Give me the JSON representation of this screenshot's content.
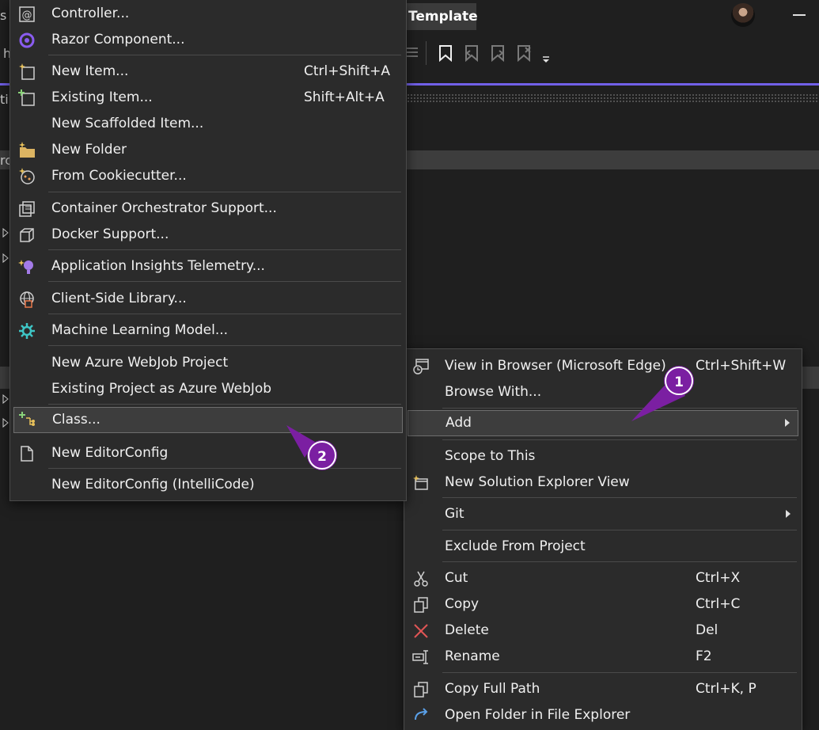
{
  "titlebar": {
    "title": "Template",
    "left_fragment": "s"
  },
  "left_edge": {
    "items": [
      "h",
      "ti",
      "rc"
    ]
  },
  "left_menu": {
    "items": [
      {
        "label": "Controller...",
        "shortcut": "",
        "icon": "controller-icon"
      },
      {
        "label": "Razor Component...",
        "shortcut": "",
        "icon": "razor-component-icon"
      },
      {
        "label": "New Item...",
        "shortcut": "Ctrl+Shift+A",
        "icon": "new-item-icon"
      },
      {
        "label": "Existing Item...",
        "shortcut": "Shift+Alt+A",
        "icon": "existing-item-icon"
      },
      {
        "label": "New Scaffolded Item...",
        "shortcut": "",
        "icon": ""
      },
      {
        "label": "New Folder",
        "shortcut": "",
        "icon": "new-folder-icon"
      },
      {
        "label": "From Cookiecutter...",
        "shortcut": "",
        "icon": "cookiecutter-icon"
      },
      {
        "label": "Container Orchestrator Support...",
        "shortcut": "",
        "icon": "container-orchestrator-icon"
      },
      {
        "label": "Docker Support...",
        "shortcut": "",
        "icon": "docker-icon"
      },
      {
        "label": "Application Insights Telemetry...",
        "shortcut": "",
        "icon": "application-insights-icon"
      },
      {
        "label": "Client-Side Library...",
        "shortcut": "",
        "icon": "client-side-library-icon"
      },
      {
        "label": "Machine Learning Model...",
        "shortcut": "",
        "icon": "machine-learning-icon"
      },
      {
        "label": "New Azure WebJob Project",
        "shortcut": "",
        "icon": ""
      },
      {
        "label": "Existing Project as Azure WebJob",
        "shortcut": "",
        "icon": ""
      },
      {
        "label": "Class...",
        "shortcut": "",
        "icon": "class-icon"
      },
      {
        "label": "New EditorConfig",
        "shortcut": "",
        "icon": "editorconfig-icon"
      },
      {
        "label": "New EditorConfig (IntelliCode)",
        "shortcut": "",
        "icon": ""
      }
    ]
  },
  "right_menu": {
    "items": [
      {
        "label": "View in Browser (Microsoft Edge)",
        "shortcut": "Ctrl+Shift+W",
        "icon": "view-in-browser-icon"
      },
      {
        "label": "Browse With...",
        "shortcut": "",
        "icon": ""
      },
      {
        "label": "Add",
        "shortcut": "",
        "icon": ""
      },
      {
        "label": "Scope to This",
        "shortcut": "",
        "icon": ""
      },
      {
        "label": "New Solution Explorer View",
        "shortcut": "",
        "icon": "new-solution-explorer-view-icon"
      },
      {
        "label": "Git",
        "shortcut": "",
        "icon": ""
      },
      {
        "label": "Exclude From Project",
        "shortcut": "",
        "icon": ""
      },
      {
        "label": "Cut",
        "shortcut": "Ctrl+X",
        "icon": "cut-icon"
      },
      {
        "label": "Copy",
        "shortcut": "Ctrl+C",
        "icon": "copy-icon"
      },
      {
        "label": "Delete",
        "shortcut": "Del",
        "icon": "delete-icon"
      },
      {
        "label": "Rename",
        "shortcut": "F2",
        "icon": "rename-icon"
      },
      {
        "label": "Copy Full Path",
        "shortcut": "Ctrl+K, P",
        "icon": "copy-full-path-icon"
      },
      {
        "label": "Open Folder in File Explorer",
        "shortcut": "",
        "icon": "open-folder-icon"
      }
    ]
  },
  "callouts": {
    "one": "1",
    "two": "2"
  },
  "colors": {
    "accent": "#7160e8",
    "callout": "#7b1fa2",
    "delete": "#e05555"
  }
}
